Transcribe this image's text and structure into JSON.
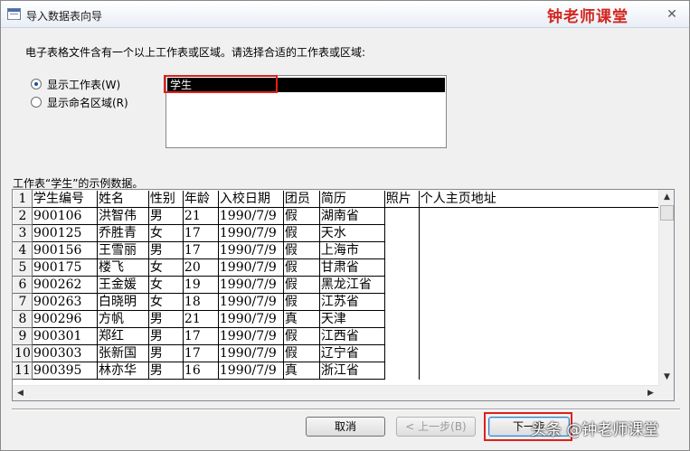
{
  "window": {
    "title": "导入数据表向导",
    "watermark": "钟老师课堂",
    "close_glyph": "✕"
  },
  "instruction": "电子表格文件含有一个以上工作表或区域。请选择合适的工作表或区域:",
  "options": {
    "show_sheets": "显示工作表(W)",
    "show_named_ranges": "显示命名区域(R)",
    "selected": "show_sheets"
  },
  "sheet_list": {
    "items": [
      "学生"
    ],
    "selected": "学生"
  },
  "sample_caption": "工作表“学生”的示例数据。",
  "grid": {
    "row_numbers": [
      "1",
      "2",
      "3",
      "4",
      "5",
      "6",
      "7",
      "8",
      "9",
      "10",
      "11"
    ],
    "rows": [
      [
        "学生编号",
        "姓名",
        "性别",
        "年龄",
        "入校日期",
        "团员",
        "简历",
        "照片",
        "个人主页地址"
      ],
      [
        "900106",
        "洪智伟",
        "男",
        "21",
        "1990/7/9",
        "假",
        "湖南省",
        "",
        ""
      ],
      [
        "900125",
        "乔胜青",
        "女",
        "17",
        "1990/7/9",
        "假",
        "天水",
        "",
        ""
      ],
      [
        "900156",
        "王雪丽",
        "男",
        "17",
        "1990/7/9",
        "假",
        "上海市",
        "",
        ""
      ],
      [
        "900175",
        "楼飞",
        "女",
        "20",
        "1990/7/9",
        "假",
        "甘肃省",
        "",
        ""
      ],
      [
        "900262",
        "王金媛",
        "女",
        "19",
        "1990/7/9",
        "假",
        "黑龙江省",
        "",
        ""
      ],
      [
        "900263",
        "白晓明",
        "女",
        "18",
        "1990/7/9",
        "假",
        "江苏省",
        "",
        ""
      ],
      [
        "900296",
        "方帆",
        "男",
        "21",
        "1990/7/9",
        "真",
        "天津",
        "",
        ""
      ],
      [
        "900301",
        "郑红",
        "男",
        "17",
        "1990/7/9",
        "假",
        "江西省",
        "",
        ""
      ],
      [
        "900303",
        "张新国",
        "男",
        "17",
        "1990/7/9",
        "假",
        "辽宁省",
        "",
        ""
      ],
      [
        "900395",
        "林亦华",
        "男",
        "16",
        "1990/7/9",
        "真",
        "浙江省",
        "",
        ""
      ]
    ]
  },
  "buttons": {
    "cancel": "取消",
    "back": "< 上一步(B)",
    "next": "下一步"
  },
  "overlay_watermark": "头条 @钟老师课堂",
  "icons": {
    "scroll_up": "▲",
    "scroll_down": "▼",
    "scroll_left": "◀",
    "scroll_right": "▶"
  },
  "colors": {
    "highlight": "#e0201b",
    "watermark": "#d3261f"
  }
}
